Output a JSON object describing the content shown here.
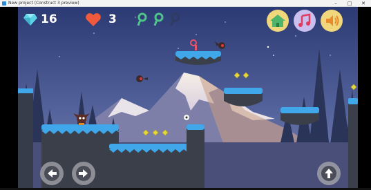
{
  "window": {
    "title": "New project (Construct 3 preview)",
    "minimize_glyph": "–",
    "maximize_glyph": "□",
    "close_glyph": "✕"
  },
  "hud": {
    "gems": 16,
    "lives": 3,
    "keys_total": 3,
    "keys_collected": 2,
    "gem_icon": "diamond-icon",
    "lives_icon": "heart-icon",
    "key_icon": "key-icon",
    "buttons": [
      {
        "icon": "home-icon"
      },
      {
        "icon": "music-note-icon"
      },
      {
        "icon": "speaker-icon"
      }
    ]
  },
  "controls": {
    "left_icon": "arrow-left-icon",
    "right_icon": "arrow-right-icon",
    "jump_icon": "arrow-up-icon"
  },
  "colors": {
    "sky_top": "#2f3f78",
    "sky_bottom": "#6a79a8",
    "ice": "#3fa7ea",
    "ground": "#3a3f4a",
    "gem": "#5ed3e8",
    "heart": "#f05a3c",
    "key": "#4fc48a",
    "coin": "#e6d73a"
  }
}
